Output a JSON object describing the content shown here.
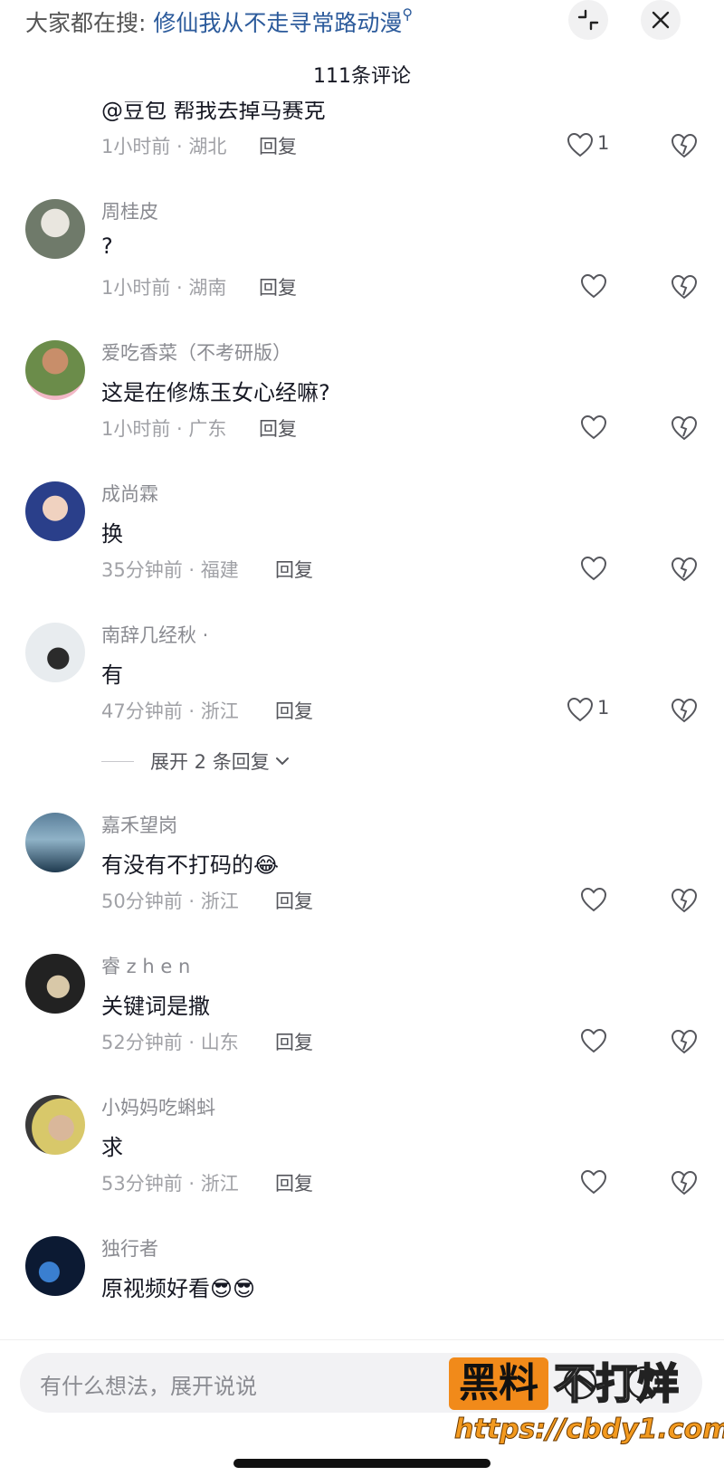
{
  "header": {
    "search_prefix": "大家都在搜:",
    "search_keyword": "修仙我从不走寻常路动漫",
    "comment_count_title": "111条评论"
  },
  "comments": [
    {
      "username": "",
      "text": "@豆包 帮我去掉马赛克",
      "time": "1小时前 · 湖北",
      "reply": "回复",
      "likes": "1"
    },
    {
      "username": "周桂皮",
      "text": "?",
      "time": "1小时前 · 湖南",
      "reply": "回复",
      "likes": ""
    },
    {
      "username": "爱吃香菜（不考研版）",
      "text": "这是在修炼玉女心经嘛?",
      "time": "1小时前 · 广东",
      "reply": "回复",
      "likes": ""
    },
    {
      "username": "成尚霖",
      "text": "换",
      "time": "35分钟前 · 福建",
      "reply": "回复",
      "likes": ""
    },
    {
      "username": "南辞几经秋 ·",
      "text": "有",
      "time": "47分钟前 · 浙江",
      "reply": "回复",
      "likes": "1"
    },
    {
      "username": "嘉禾望岗",
      "text": "有没有不打码的😂",
      "time": "50分钟前 · 浙江",
      "reply": "回复",
      "likes": ""
    },
    {
      "username": "睿 z h e n",
      "text": "关键词是撒",
      "time": "52分钟前 · 山东",
      "reply": "回复",
      "likes": ""
    },
    {
      "username": "小妈妈吃蝌蚪",
      "text": "求",
      "time": "53分钟前 · 浙江",
      "reply": "回复",
      "likes": ""
    },
    {
      "username": "独行者",
      "text": "原视频好看😎😎",
      "time": "",
      "reply": "",
      "likes": ""
    }
  ],
  "expand_replies": "展开 2 条回复",
  "input": {
    "placeholder": "有什么想法，展开说说"
  },
  "watermark": {
    "title_box": "黑料",
    "title_rest": "不打烊",
    "url": "https://cbdy1.com"
  },
  "colors": {
    "accent_link": "#2b5a9b",
    "watermark_orange": "#f18a1a"
  },
  "icons": [
    "collapse-icon",
    "close-icon",
    "heart-icon",
    "broken-heart-icon",
    "emoji-icon",
    "at-icon"
  ]
}
